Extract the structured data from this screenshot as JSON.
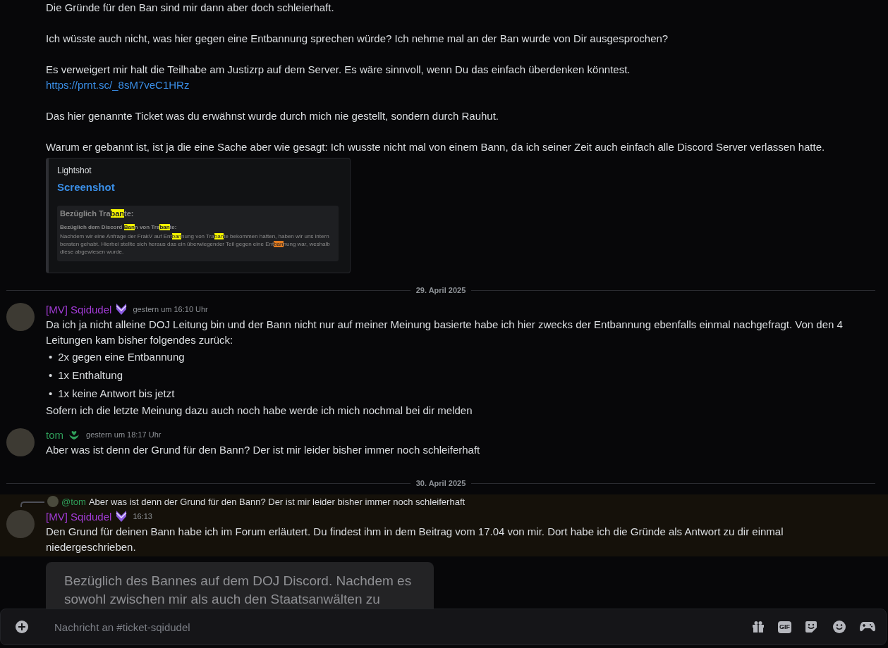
{
  "feed": [
    {
      "kind": "continuation",
      "paragraphs": [
        [
          {
            "kind": "text",
            "text": "Die Gründe für den Ban sind mir dann aber doch schleierhaft."
          }
        ],
        [
          {
            "kind": "text",
            "text": "Ich wüsste auch nicht, was hier gegen eine Entbannung sprechen würde? Ich nehme mal an der Ban wurde von Dir ausgesprochen?"
          }
        ],
        [
          {
            "kind": "text",
            "text": "Es verweigert mir halt die Teilhabe am Justizrp auf dem Server. Es wäre sinnvoll, wenn Du das einfach überdenken könntest."
          },
          {
            "kind": "link",
            "text": "https://prnt.sc/_8sM7veC1HRz"
          }
        ],
        [
          {
            "kind": "text",
            "text": "Das hier genannte Ticket was du erwähnst wurde durch mich nie gestellt, sondern durch Rauhut."
          }
        ],
        [
          {
            "kind": "text",
            "text": "Warum er gebannt ist, ist ja die eine Sache aber wie gesagt: Ich wusste nicht mal von einem Bann, da ich seiner Zeit auch einfach alle Discord Server verlassen hatte."
          }
        ]
      ],
      "embed": {
        "provider": "Lightshot",
        "title": "Screenshot",
        "image": {
          "heading": [
            {
              "kind": "plain",
              "text": "Bezüglich Tra"
            },
            {
              "kind": "match",
              "text": "ban"
            },
            {
              "kind": "plain",
              "text": "te:"
            }
          ],
          "subheading": [
            {
              "kind": "plain",
              "text": "Bezüglich dem Discord "
            },
            {
              "kind": "match",
              "text": "Ban"
            },
            {
              "kind": "plain",
              "text": "n von Tra"
            },
            {
              "kind": "match",
              "text": "ban"
            },
            {
              "kind": "plain",
              "text": "te:"
            }
          ],
          "body": [
            {
              "kind": "plain",
              "text": "Nachdem wir eine Anfrage der FrakV auf Ent"
            },
            {
              "kind": "match",
              "text": "ban"
            },
            {
              "kind": "plain",
              "text": "nung von Tra"
            },
            {
              "kind": "match",
              "text": "ban"
            },
            {
              "kind": "plain",
              "text": "te bekommen hatten, haben wir uns intern beraten gehabt. Hierbei stellte sich heraus das ein überwiegender Teil gegen eine Ent"
            },
            {
              "kind": "current",
              "text": "ban"
            },
            {
              "kind": "plain",
              "text": "nung war, weshalb diese abgewiesen wurde."
            }
          ]
        }
      }
    },
    {
      "kind": "date_divider",
      "label": "29. April 2025"
    },
    {
      "kind": "message",
      "author": "[MV] Sqidudel",
      "color": "#a23bd6",
      "badge": {
        "kind": "chevron"
      },
      "timestamp": "gestern um 16:10 Uhr",
      "content": [
        {
          "kind": "text",
          "text": "Da ich ja nicht alleine DOJ Leitung bin und der Bann nicht nur auf meiner Meinung basierte habe ich hier zwecks der Entbannung ebenfalls einmal nachgefragt. Von den 4 Leitungen kam bisher folgendes zurück:"
        },
        {
          "kind": "bullet",
          "marker": "•",
          "text": "2x gegen eine Entbannung"
        },
        {
          "kind": "bullet",
          "marker": "•",
          "text": "1x Enthaltung"
        },
        {
          "kind": "bullet",
          "marker": "•",
          "text": "1x keine Antwort bis jetzt"
        },
        {
          "kind": "text",
          "text": "Sofern ich die letzte Meinung dazu auch noch habe werde ich mich nochmal bei dir melden"
        }
      ]
    },
    {
      "kind": "message",
      "author": "tom",
      "color": "#2f9e5a",
      "badge": {
        "kind": "leaf"
      },
      "timestamp": "gestern um 18:17 Uhr",
      "content": [
        {
          "kind": "text",
          "text": "Aber was ist denn der Grund für den Bann? Der ist mir leider bisher immer noch schleiferhaft"
        }
      ]
    },
    {
      "kind": "date_divider",
      "label": "30. April 2025"
    },
    {
      "kind": "message",
      "author": "[MV] Sqidudel",
      "color": "#a23bd6",
      "badge": {
        "kind": "chevron"
      },
      "timestamp": "16:13",
      "highlighted": true,
      "reply": {
        "mention": "@tom",
        "color": "#2f9e5a",
        "text": "Aber was ist denn der Grund für den Bann? Der ist mir leider bisher immer noch schleiferhaft"
      },
      "content": [
        {
          "kind": "text",
          "text": "Den Grund für deinen Bann habe ich im Forum erläutert. Du findest ihm in dem Beitrag vom 17.04 von mir. Dort habe ich die Gründe als Antwort zu dir einmal niedergeschrieben."
        }
      ],
      "card": {
        "text": "Bezüglich des Bannes auf dem DOJ Discord. Nachdem es sowohl zwischen mir als auch den Staatsanwälten zu"
      }
    }
  ],
  "composer": {
    "placeholder": "Nachricht an #ticket-sqidudel",
    "gif_label": "GIF"
  }
}
